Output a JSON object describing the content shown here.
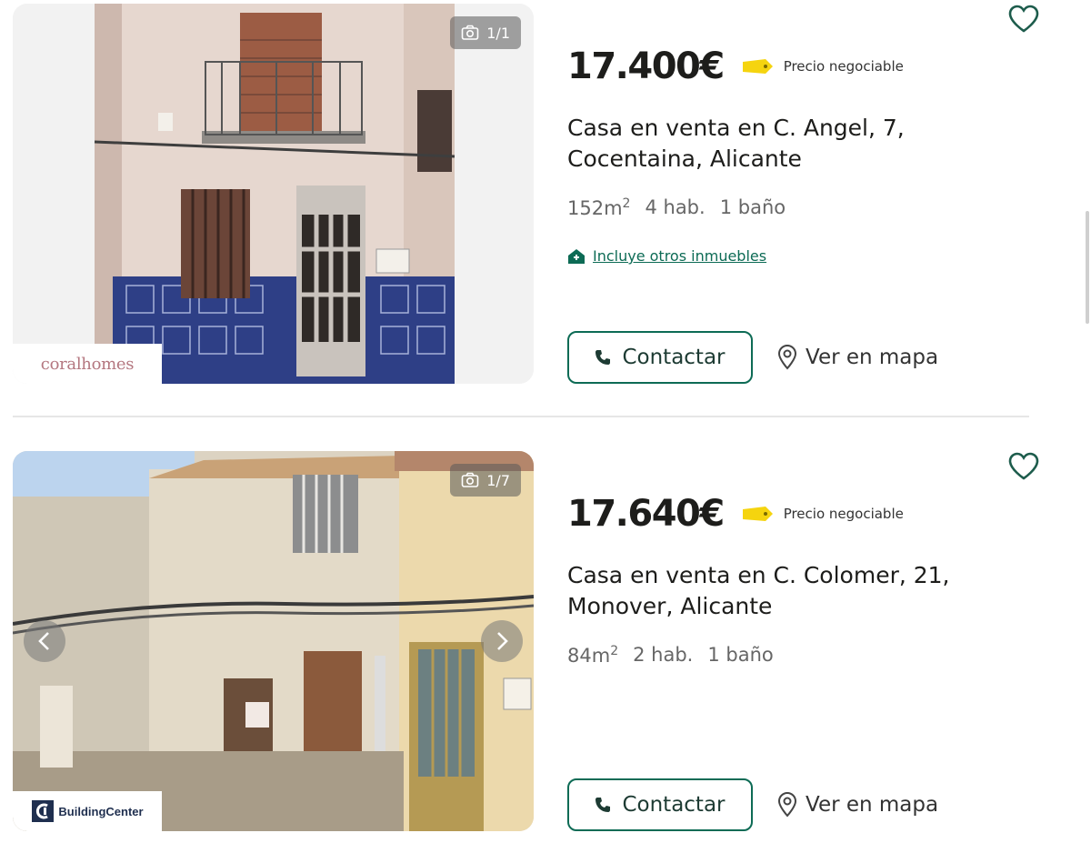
{
  "listings": [
    {
      "photo_counter": "1/1",
      "agency": "coralhomes",
      "price": "17.400€",
      "negotiable": "Precio negociable",
      "title": "Casa en venta en C. Angel, 7, Cocentaina, Alicante",
      "features": {
        "area": "152m",
        "area_unit": "2",
        "rooms": "4 hab.",
        "baths": "1 baño"
      },
      "extra_link": "Incluye otros inmuebles",
      "contact_label": "Contactar",
      "map_label": "Ver en mapa"
    },
    {
      "photo_counter": "1/7",
      "agency": "BuildingCenter",
      "price": "17.640€",
      "negotiable": "Precio negociable",
      "title": "Casa en venta en C. Colomer, 21, Monover, Alicante",
      "features": {
        "area": "84m",
        "area_unit": "2",
        "rooms": "2 hab.",
        "baths": "1 baño"
      },
      "contact_label": "Contactar",
      "map_label": "Ver en mapa"
    }
  ],
  "colors": {
    "accent": "#0d6b55",
    "tag": "#f5d40f",
    "text": "#1d1d1b",
    "muted": "#666666"
  },
  "icons": [
    "camera-icon",
    "heart-icon",
    "phone-icon",
    "map-pin-icon",
    "house-icon",
    "price-tag-icon",
    "chevron-left-icon",
    "chevron-right-icon"
  ]
}
